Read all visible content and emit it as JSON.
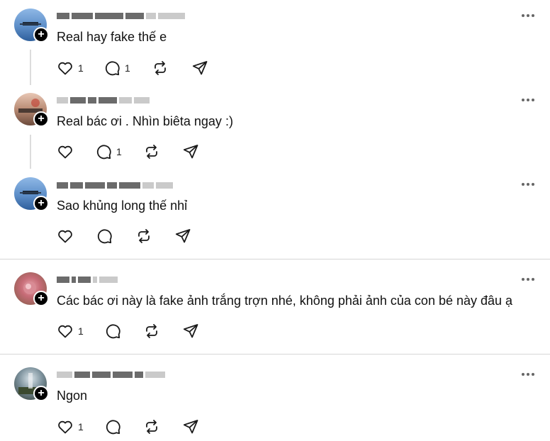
{
  "comments": [
    {
      "text": "Real hay fake thế e",
      "like_count": "1",
      "reply_count": "1"
    },
    {
      "text": "Real bác ơi . Nhìn biêta ngay :)",
      "like_count": "",
      "reply_count": "1"
    },
    {
      "text": "Sao khủng long thế nhỉ",
      "like_count": "",
      "reply_count": ""
    },
    {
      "text": "Các bác ơi này là fake ảnh trắng trợn nhé, không phải ảnh của con bé này đâu ạ",
      "like_count": "1",
      "reply_count": ""
    },
    {
      "text": "Ngon",
      "like_count": "1",
      "reply_count": ""
    }
  ],
  "icons": {
    "like": "heart-icon",
    "reply": "comment-icon",
    "repost": "repost-icon",
    "share": "send-icon",
    "more": "more-icon",
    "follow": "plus-icon"
  },
  "colors": {
    "icon": "#1a1a1a",
    "divider": "#d6d6d6",
    "thread_line": "#dcdcdc"
  }
}
